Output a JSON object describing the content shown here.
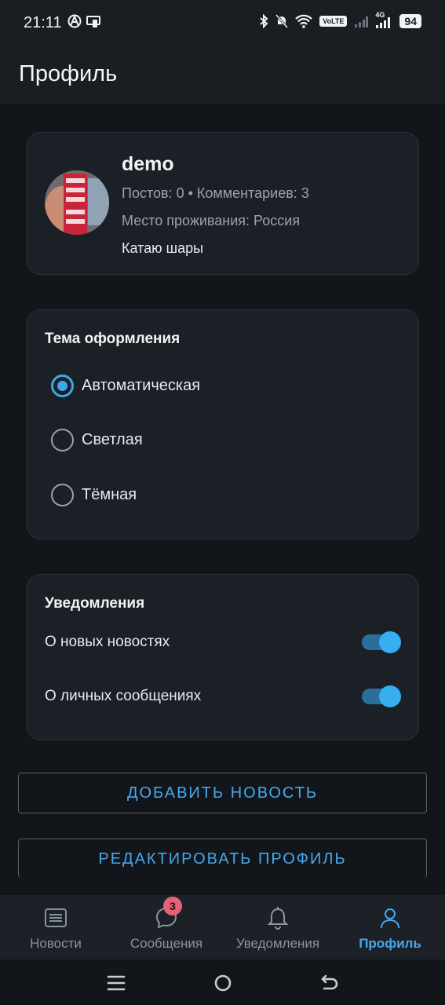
{
  "status_bar": {
    "time": "21:11",
    "volte": "VoLTE",
    "network": "4G",
    "battery": "94"
  },
  "app_bar": {
    "title": "Профиль"
  },
  "profile": {
    "username": "demo",
    "stats": "Постов: 0 • Комментариев: 3",
    "location": "Место проживания: Россия",
    "status": "Катаю шары"
  },
  "theme": {
    "title": "Тема оформления",
    "options": [
      {
        "label": "Автоматическая",
        "selected": true
      },
      {
        "label": "Светлая",
        "selected": false
      },
      {
        "label": "Тёмная",
        "selected": false
      }
    ]
  },
  "notifications": {
    "title": "Уведомления",
    "items": [
      {
        "label": "О новых новостях",
        "enabled": true
      },
      {
        "label": "О личных сообщениях",
        "enabled": true
      }
    ]
  },
  "actions": {
    "add_news": "ДОБАВИТЬ НОВОСТЬ",
    "edit_profile": "РЕДАКТИРОВАТЬ ПРОФИЛЬ"
  },
  "bottom_nav": {
    "items": [
      {
        "label": "Новости",
        "icon": "news-icon",
        "active": false
      },
      {
        "label": "Сообщения",
        "icon": "chat-bubble-icon",
        "active": false,
        "badge": "3"
      },
      {
        "label": "Уведомления",
        "icon": "bell-icon",
        "active": false
      },
      {
        "label": "Профиль",
        "icon": "person-icon",
        "active": true
      }
    ]
  },
  "colors": {
    "accent": "#3aa7ea",
    "background": "#12161b",
    "card": "#1b2026",
    "badge": "#e36179"
  }
}
